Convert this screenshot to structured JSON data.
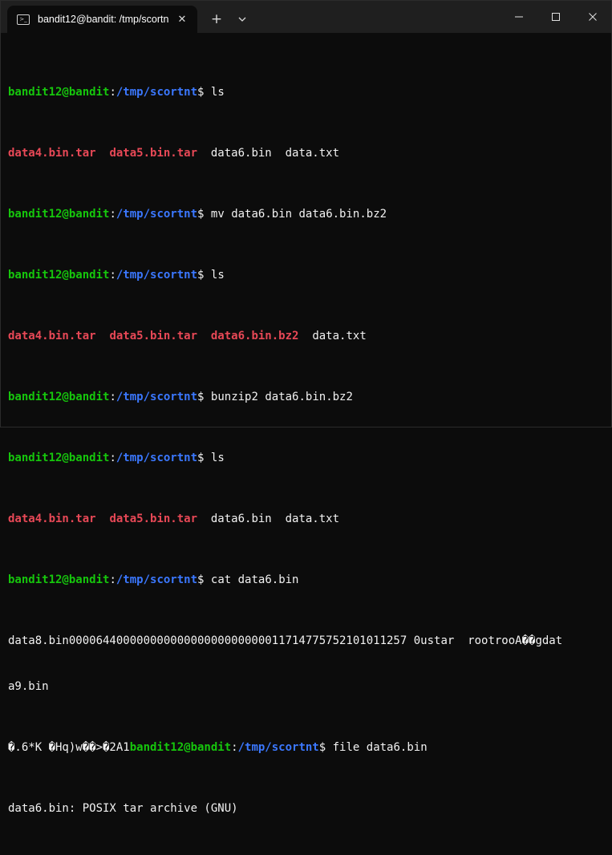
{
  "window": {
    "tab_title": "bandit12@bandit: /tmp/scortn",
    "tab_icon": "terminal-icon",
    "new_tab_glyph": "+",
    "close_glyph": "✕"
  },
  "colors": {
    "user_host": "#16c60c",
    "path": "#3b78ff",
    "archive_files": "#e74856",
    "text": "#cccccc",
    "background": "#0c0c0c",
    "titlebar": "#1f1f1f"
  },
  "terminal": {
    "user_host": "bandit12@bandit",
    "colon": ":",
    "path": "/tmp/scortnt",
    "dollar": "$",
    "cmd_ls": "ls",
    "cmd_mv": "mv data6.bin data6.bin.bz2",
    "cmd_bunzip": "bunzip2 data6.bin.bz2",
    "cmd_cat": "cat data6.bin",
    "cmd_file": "file data6.bin",
    "f_data4": "data4.bin.tar",
    "f_data5": "data5.bin.tar",
    "f_data6": "data6.bin",
    "f_data6_bz2": "data6.bin.bz2",
    "f_datatxt": "data.txt",
    "sep": "  ",
    "cat_line1": "data8.bin0000644000000000000000000000001171477575210101125​7 0ustar  rootrooA��gdat",
    "cat_line2": "a9.bin",
    "cat_line3": "�.6*K �Hq)w��>�2A1",
    "file_result": "data6.bin: POSIX tar archive (GNU)"
  }
}
